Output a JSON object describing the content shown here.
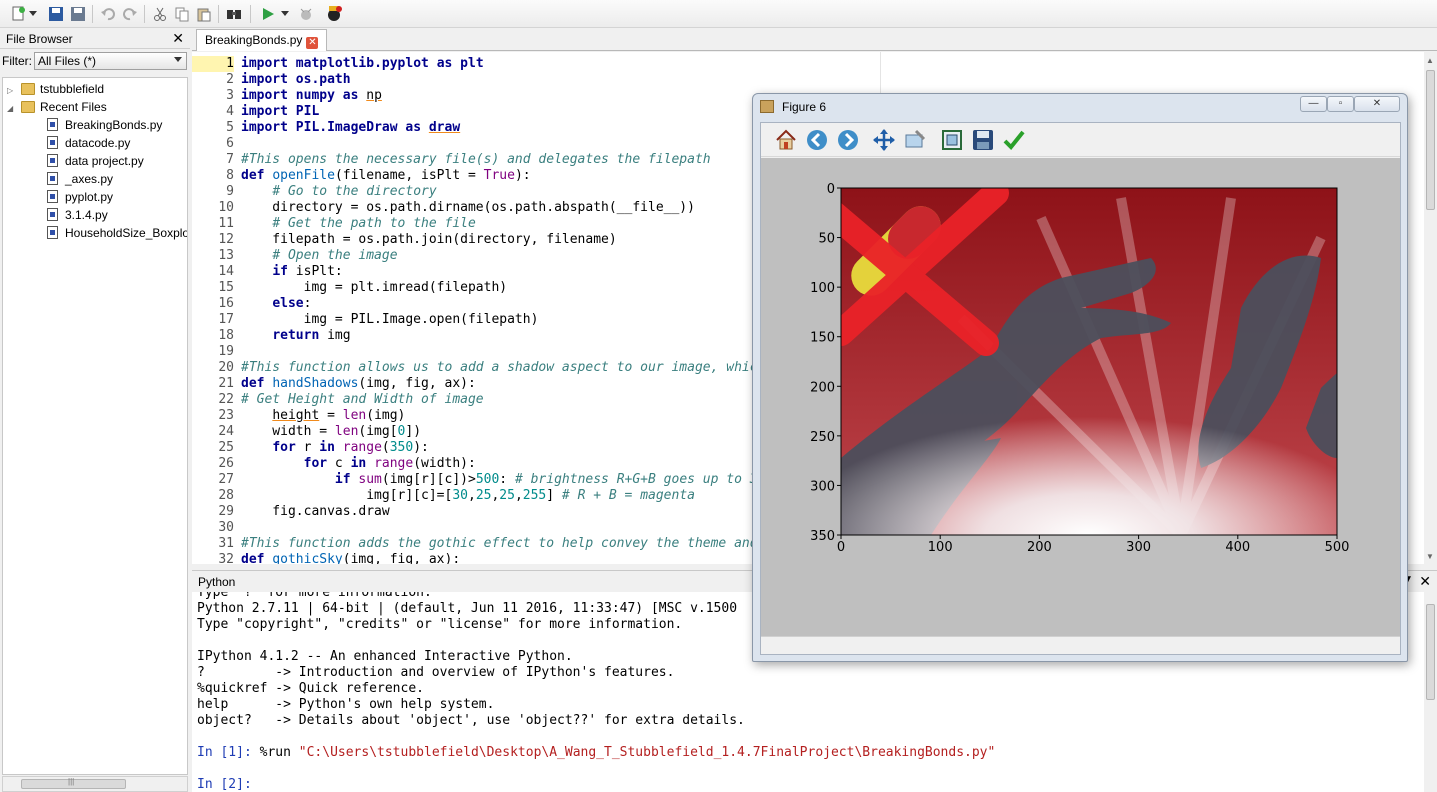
{
  "toolbar": {
    "icons": [
      "new-file-icon",
      "dropdown-arrow-icon",
      "save-icon",
      "save-all-icon",
      "undo-icon",
      "redo-icon",
      "cut-icon",
      "copy-icon",
      "paste-icon",
      "find-icon",
      "run-icon",
      "run-dropdown-icon",
      "debug-icon",
      "stop-icon"
    ]
  },
  "file_browser": {
    "title": "File Browser",
    "close": "✕",
    "filter_label": "Filter:",
    "filter_value": "All Files (*)",
    "folders": [
      {
        "label": "tstubblefield",
        "expander": "▷"
      },
      {
        "label": "Recent Files",
        "expander": "◢"
      }
    ],
    "files": [
      "BreakingBonds.py",
      "datacode.py",
      "data project.py",
      "_axes.py",
      "pyplot.py",
      "3.1.4.py",
      "HouseholdSize_Boxplot"
    ],
    "scroll_grip": "|||"
  },
  "editor": {
    "tab_label": "BreakingBonds.py",
    "tab_close": "✕",
    "current_line": 1
  },
  "console": {
    "title": "Python",
    "close": "✕",
    "float": "▼",
    "lines": [
      "Type \"?\" for more information.",
      "Python 2.7.11 | 64-bit | (default, Jun 11 2016, 11:33:47) [MSC v.1500",
      "Type \"copyright\", \"credits\" or \"license\" for more information.",
      "",
      "IPython 4.1.2 -- An enhanced Interactive Python.",
      "?         -> Introduction and overview of IPython's features.",
      "%quickref -> Quick reference.",
      "help      -> Python's own help system.",
      "object?   -> Details about 'object', use 'object??' for extra details.",
      ""
    ],
    "prompt1": "In [1]:",
    "cmd1_pre": " %run ",
    "cmd1_str": "\"C:\\Users\\tstubblefield\\Desktop\\A_Wang_T_Stubblefield_1.4.7FinalProject\\BreakingBonds.py\"",
    "blank": "",
    "prompt2": "In [2]:"
  },
  "figure": {
    "title": "Figure 6",
    "min": "—",
    "max": "▫",
    "close": "✕",
    "tools": [
      "home-icon",
      "back-icon",
      "forward-icon",
      "pan-icon",
      "zoom-icon",
      "configure-subplots-icon",
      "save-figure-icon",
      "edit-axes-icon"
    ]
  },
  "chart_data": {
    "type": "image",
    "x_ticks": [
      "0",
      "100",
      "200",
      "300",
      "400",
      "500"
    ],
    "y_ticks": [
      "0",
      "50",
      "100",
      "150",
      "200",
      "250",
      "300",
      "350"
    ],
    "xlim": [
      0,
      500
    ],
    "ylim": [
      350,
      0
    ],
    "colors": {
      "background_red": "#9b1a20",
      "shadow": "#4b4e5a",
      "cross": "#e8262a",
      "pill_yellow": "#e4d23b",
      "pill_red": "#c8282e"
    }
  }
}
